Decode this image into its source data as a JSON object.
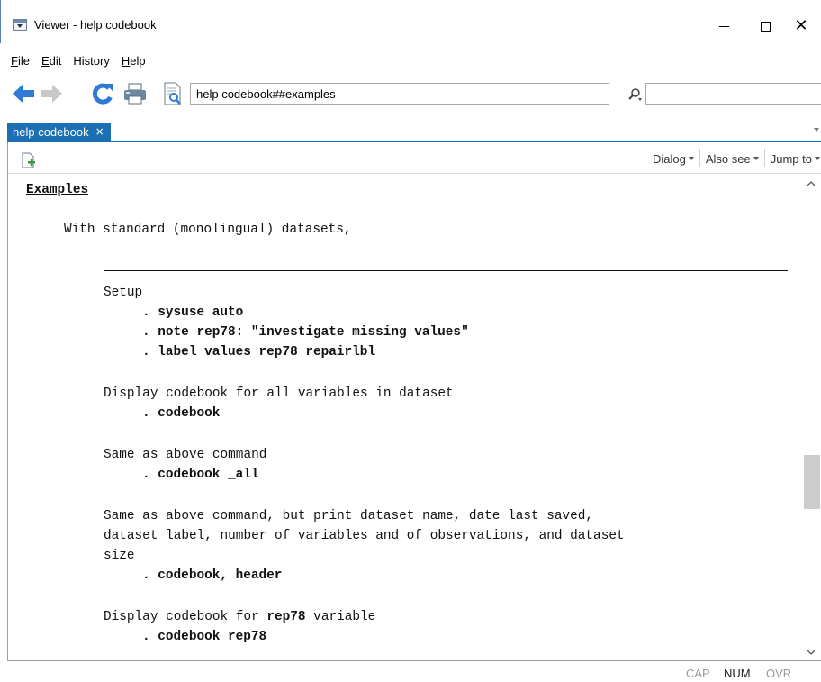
{
  "window": {
    "title": "Viewer - help codebook"
  },
  "menu": {
    "items": [
      {
        "pre": "",
        "ul": "F",
        "post": "ile"
      },
      {
        "pre": "",
        "ul": "E",
        "post": "dit"
      },
      {
        "pre": "History",
        "ul": "",
        "post": ""
      },
      {
        "pre": "",
        "ul": "H",
        "post": "elp"
      }
    ]
  },
  "toolbar": {
    "address": "help codebook##examples",
    "search_value": ""
  },
  "tab": {
    "label": "help codebook",
    "close": "×"
  },
  "subtoolbar": {
    "dialog": "Dialog",
    "also_see": "Also see",
    "jump_to": "Jump to"
  },
  "content": {
    "heading": "Examples",
    "intro": "With standard (monolingual) datasets,",
    "setup_label": "Setup",
    "setup_cmds": [
      ". sysuse auto",
      ". note rep78: \"investigate missing values\"",
      ". label values rep78 repairlbl"
    ],
    "ex1_desc": "Display codebook for all variables in dataset",
    "ex1_cmd": ". codebook",
    "ex2_desc": "Same as above command",
    "ex2_cmd": ". codebook _all",
    "ex3_desc_lines": [
      "Same as above command, but print dataset name, date last saved,",
      "dataset label, number of variables and of observations, and dataset",
      "size"
    ],
    "ex3_cmd": ". codebook, header",
    "ex4_desc_pre": "Display codebook for ",
    "ex4_desc_bold": "rep78",
    "ex4_desc_post": " variable",
    "ex4_cmd": ". codebook rep78"
  },
  "status": {
    "cap": "CAP",
    "num": "NUM",
    "ovr": "OVR"
  },
  "colors": {
    "tab_bg": "#1c6fb3",
    "back_arrow": "#2d7bd5",
    "refresh": "#2d7bd5"
  }
}
